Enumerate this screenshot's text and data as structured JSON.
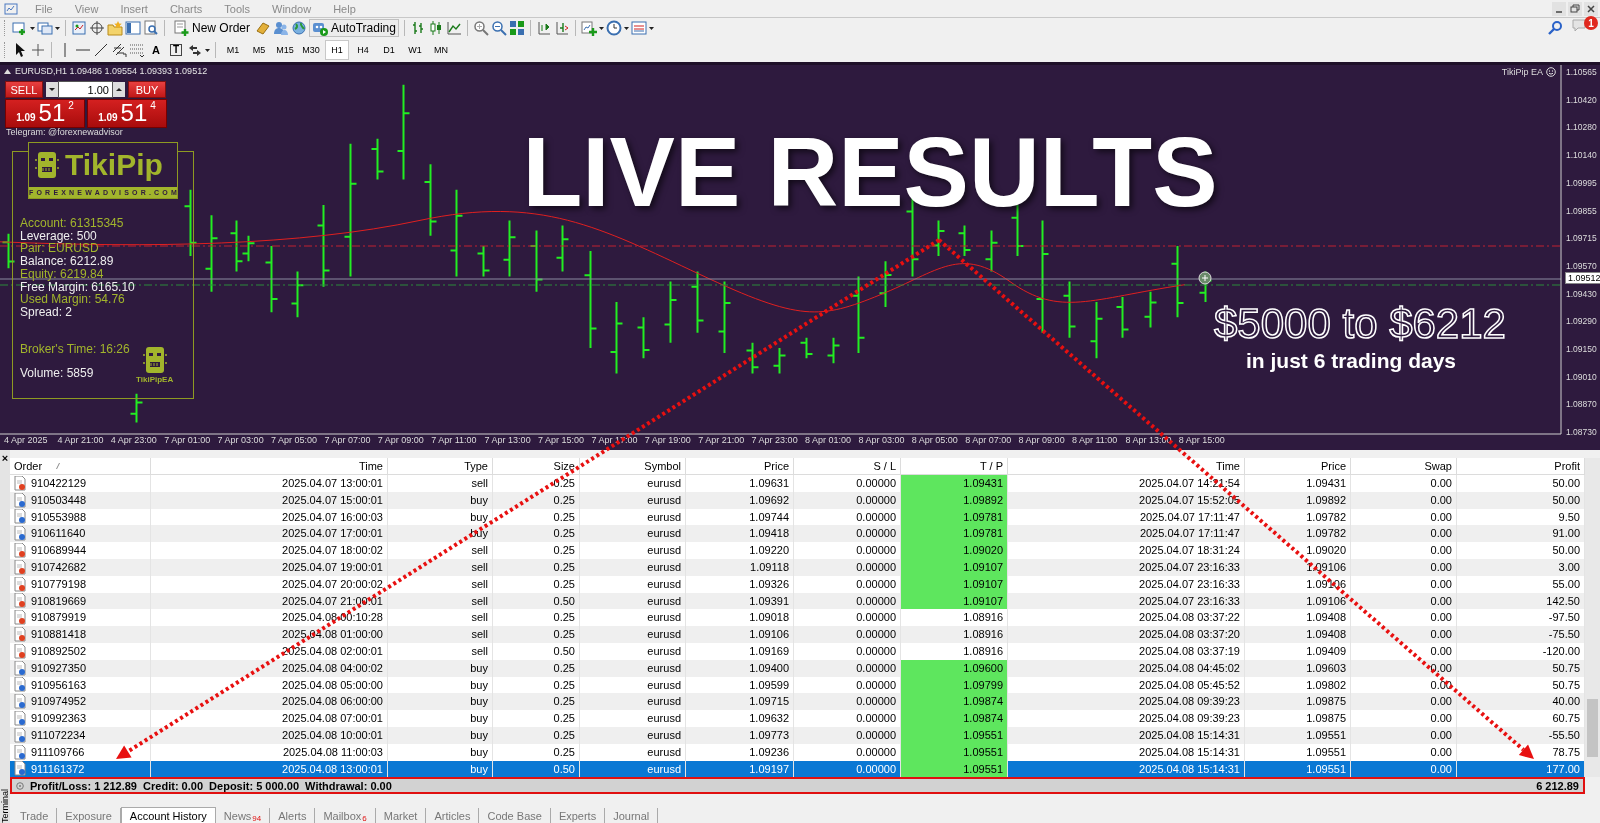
{
  "menu": [
    "File",
    "View",
    "Insert",
    "Charts",
    "Tools",
    "Window",
    "Help"
  ],
  "toolbar": {
    "new_order": "New Order",
    "autotrading": "AutoTrading",
    "text_tool": "A",
    "label_tool": "T",
    "notification_count": "1",
    "timeframes": [
      {
        "label": "M1",
        "selected": false
      },
      {
        "label": "M5",
        "selected": false
      },
      {
        "label": "M15",
        "selected": false
      },
      {
        "label": "M30",
        "selected": false
      },
      {
        "label": "H1",
        "selected": true
      },
      {
        "label": "H4",
        "selected": false
      },
      {
        "label": "D1",
        "selected": false
      },
      {
        "label": "W1",
        "selected": false
      },
      {
        "label": "MN",
        "selected": false
      }
    ]
  },
  "chart": {
    "header": "EURUSD,H1  1.09486 1.09554 1.09393 1.09512",
    "trade_panel": {
      "sell": "SELL",
      "buy": "BUY",
      "lots": "1.00",
      "sell_price": {
        "base": "1.09",
        "pips": "51",
        "point": "2"
      },
      "buy_price": {
        "base": "1.09",
        "pips": "51",
        "point": "4"
      }
    },
    "telegram": "Telegram: @forexnewadvisor",
    "ea_label": "TikiPip EA",
    "info_panel": {
      "logo": "TikiPip",
      "site": "FOREXNEWADVISOR.COM",
      "badge_logo": "TikiPipEA",
      "lines": [
        {
          "text": "Account: 61315345",
          "color": "#a2b52c"
        },
        {
          "text": "Leverage: 500",
          "color": "#eeeeee"
        },
        {
          "text": "Pair: EURUSD",
          "color": "#a2b52c"
        },
        {
          "text": "Balance: 6212.89",
          "color": "#eeeeee"
        },
        {
          "text": "Equity: 6219.84",
          "color": "#a2b52c"
        },
        {
          "text": "Free Margin: 6165.10",
          "color": "#eeeeee"
        },
        {
          "text": "Used Margin: 54.76",
          "color": "#a2b52c"
        },
        {
          "text": "Spread: 2",
          "color": "#eeeeee"
        }
      ],
      "footer_lines": [
        {
          "text": "Broker's Time: 16:26",
          "color": "#a2b52c"
        },
        {
          "text": "Volume: 5859",
          "color": "#eeeeee"
        }
      ]
    },
    "price_axis": [
      "1.10565",
      "1.10420",
      "1.10280",
      "1.10140",
      "1.09995",
      "1.09855",
      "1.09715",
      "1.09570",
      "1.09430",
      "1.09290",
      "1.09150",
      "1.09010",
      "1.08870",
      "1.08730"
    ],
    "current_price": "1.09512",
    "time_axis": [
      "4 Apr 2025",
      "4 Apr 21:00",
      "4 Apr 23:00",
      "7 Apr 01:00",
      "7 Apr 03:00",
      "7 Apr 05:00",
      "7 Apr 07:00",
      "7 Apr 09:00",
      "7 Apr 11:00",
      "7 Apr 13:00",
      "7 Apr 15:00",
      "7 Apr 17:00",
      "7 Apr 19:00",
      "7 Apr 21:00",
      "7 Apr 23:00",
      "8 Apr 01:00",
      "8 Apr 03:00",
      "8 Apr 05:00",
      "8 Apr 07:00",
      "8 Apr 09:00",
      "8 Apr 11:00",
      "8 Apr 13:00",
      "8 Apr 15:00"
    ]
  },
  "promo": {
    "headline": "LIVE RESULTS",
    "amount": "$5000 to $6212",
    "caption": "in just 6 trading days"
  },
  "terminal": {
    "close": "×",
    "label": "Terminal",
    "columns": [
      "Order",
      "Time",
      "Type",
      "Size",
      "Symbol",
      "Price",
      "S / L",
      "T / P",
      "Time",
      "Price",
      "Swap",
      "Profit"
    ],
    "rows": [
      {
        "kind": "sell",
        "selected": false,
        "tp_highlight": true,
        "cells": [
          "910422129",
          "2025.04.07 13:00:01",
          "sell",
          "0.25",
          "eurusd",
          "1.09631",
          "0.00000",
          "1.09431",
          "2025.04.07 14:21:54",
          "1.09431",
          "0.00",
          "50.00"
        ]
      },
      {
        "kind": "buy",
        "selected": false,
        "tp_highlight": true,
        "cells": [
          "910503448",
          "2025.04.07 15:00:01",
          "buy",
          "0.25",
          "eurusd",
          "1.09692",
          "0.00000",
          "1.09892",
          "2025.04.07 15:52:05",
          "1.09892",
          "0.00",
          "50.00"
        ]
      },
      {
        "kind": "buy",
        "selected": false,
        "tp_highlight": true,
        "cells": [
          "910553988",
          "2025.04.07 16:00:03",
          "buy",
          "0.25",
          "eurusd",
          "1.09744",
          "0.00000",
          "1.09781",
          "2025.04.07 17:11:47",
          "1.09782",
          "0.00",
          "9.50"
        ]
      },
      {
        "kind": "buy",
        "selected": false,
        "tp_highlight": true,
        "cells": [
          "910611640",
          "2025.04.07 17:00:01",
          "buy",
          "0.25",
          "eurusd",
          "1.09418",
          "0.00000",
          "1.09781",
          "2025.04.07 17:11:47",
          "1.09782",
          "0.00",
          "91.00"
        ]
      },
      {
        "kind": "sell",
        "selected": false,
        "tp_highlight": true,
        "cells": [
          "910689944",
          "2025.04.07 18:00:02",
          "sell",
          "0.25",
          "eurusd",
          "1.09220",
          "0.00000",
          "1.09020",
          "2025.04.07 18:31:24",
          "1.09020",
          "0.00",
          "50.00"
        ]
      },
      {
        "kind": "sell",
        "selected": false,
        "tp_highlight": true,
        "cells": [
          "910742682",
          "2025.04.07 19:00:01",
          "sell",
          "0.25",
          "eurusd",
          "1.09118",
          "0.00000",
          "1.09107",
          "2025.04.07 23:16:33",
          "1.09106",
          "0.00",
          "3.00"
        ]
      },
      {
        "kind": "sell",
        "selected": false,
        "tp_highlight": true,
        "cells": [
          "910779198",
          "2025.04.07 20:00:02",
          "sell",
          "0.25",
          "eurusd",
          "1.09326",
          "0.00000",
          "1.09107",
          "2025.04.07 23:16:33",
          "1.09106",
          "0.00",
          "55.00"
        ]
      },
      {
        "kind": "sell",
        "selected": false,
        "tp_highlight": true,
        "cells": [
          "910819669",
          "2025.04.07 21:00:01",
          "sell",
          "0.50",
          "eurusd",
          "1.09391",
          "0.00000",
          "1.09107",
          "2025.04.07 23:16:33",
          "1.09106",
          "0.00",
          "142.50"
        ]
      },
      {
        "kind": "sell",
        "selected": false,
        "tp_highlight": false,
        "cells": [
          "910879919",
          "2025.04.08 00:10:28",
          "sell",
          "0.25",
          "eurusd",
          "1.09018",
          "0.00000",
          "1.08916",
          "2025.04.08 03:37:22",
          "1.09408",
          "0.00",
          "-97.50"
        ]
      },
      {
        "kind": "sell",
        "selected": false,
        "tp_highlight": false,
        "cells": [
          "910881418",
          "2025.04.08 01:00:00",
          "sell",
          "0.25",
          "eurusd",
          "1.09106",
          "0.00000",
          "1.08916",
          "2025.04.08 03:37:20",
          "1.09408",
          "0.00",
          "-75.50"
        ]
      },
      {
        "kind": "sell",
        "selected": false,
        "tp_highlight": false,
        "cells": [
          "910892502",
          "2025.04.08 02:00:01",
          "sell",
          "0.50",
          "eurusd",
          "1.09169",
          "0.00000",
          "1.08916",
          "2025.04.08 03:37:19",
          "1.09409",
          "0.00",
          "-120.00"
        ]
      },
      {
        "kind": "buy",
        "selected": false,
        "tp_highlight": true,
        "cells": [
          "910927350",
          "2025.04.08 04:00:02",
          "buy",
          "0.25",
          "eurusd",
          "1.09400",
          "0.00000",
          "1.09600",
          "2025.04.08 04:45:02",
          "1.09603",
          "0.00",
          "50.75"
        ]
      },
      {
        "kind": "buy",
        "selected": false,
        "tp_highlight": true,
        "cells": [
          "910956163",
          "2025.04.08 05:00:00",
          "buy",
          "0.25",
          "eurusd",
          "1.09599",
          "0.00000",
          "1.09799",
          "2025.04.08 05:45:52",
          "1.09802",
          "0.00",
          "50.75"
        ]
      },
      {
        "kind": "buy",
        "selected": false,
        "tp_highlight": true,
        "cells": [
          "910974952",
          "2025.04.08 06:00:00",
          "buy",
          "0.25",
          "eurusd",
          "1.09715",
          "0.00000",
          "1.09874",
          "2025.04.08 09:39:23",
          "1.09875",
          "0.00",
          "40.00"
        ]
      },
      {
        "kind": "buy",
        "selected": false,
        "tp_highlight": true,
        "cells": [
          "910992363",
          "2025.04.08 07:00:01",
          "buy",
          "0.25",
          "eurusd",
          "1.09632",
          "0.00000",
          "1.09874",
          "2025.04.08 09:39:23",
          "1.09875",
          "0.00",
          "60.75"
        ]
      },
      {
        "kind": "buy",
        "selected": false,
        "tp_highlight": true,
        "cells": [
          "911072234",
          "2025.04.08 10:00:01",
          "buy",
          "0.25",
          "eurusd",
          "1.09773",
          "0.00000",
          "1.09551",
          "2025.04.08 15:14:31",
          "1.09551",
          "0.00",
          "-55.50"
        ]
      },
      {
        "kind": "buy",
        "selected": false,
        "tp_highlight": true,
        "cells": [
          "911109766",
          "2025.04.08 11:00:03",
          "buy",
          "0.25",
          "eurusd",
          "1.09236",
          "0.00000",
          "1.09551",
          "2025.04.08 15:14:31",
          "1.09551",
          "0.00",
          "78.75"
        ]
      },
      {
        "kind": "buy",
        "selected": true,
        "tp_highlight": true,
        "cells": [
          "911161372",
          "2025.04.08 13:00:01",
          "buy",
          "0.50",
          "eurusd",
          "1.09197",
          "0.00000",
          "1.09551",
          "2025.04.08 15:14:31",
          "1.09551",
          "0.00",
          "177.00"
        ]
      }
    ],
    "summary": {
      "text": "Profit/Loss: 1 212.89  Credit: 0.00  Deposit: 5 000.00  Withdrawal: 0.00",
      "total": "6 212.89"
    },
    "tabs": [
      {
        "label": "Trade",
        "selected": false
      },
      {
        "label": "Exposure",
        "selected": false
      },
      {
        "label": "Account History",
        "selected": true
      },
      {
        "label": "News",
        "selected": false,
        "badge": "94"
      },
      {
        "label": "Alerts",
        "selected": false
      },
      {
        "label": "Mailbox",
        "selected": false,
        "badge": "6"
      },
      {
        "label": "Market",
        "selected": false
      },
      {
        "label": "Articles",
        "selected": false
      },
      {
        "label": "Code Base",
        "selected": false
      },
      {
        "label": "Experts",
        "selected": false
      },
      {
        "label": "Journal",
        "selected": false
      }
    ]
  }
}
